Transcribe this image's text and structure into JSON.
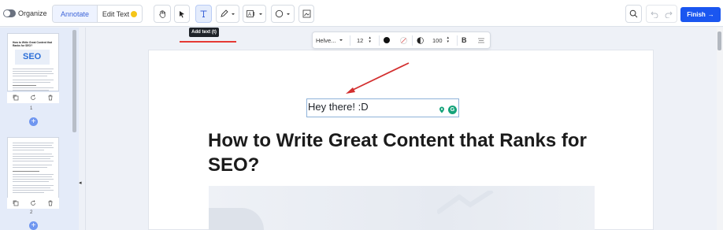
{
  "toolbar": {
    "organize_label": "Organize",
    "annotate_label": "Annotate",
    "edit_text_label": "Edit Text",
    "finish_label": "Finish"
  },
  "tooltip": {
    "text": "Add text (t)"
  },
  "text_format": {
    "font": "Helve...",
    "size": "12",
    "opacity": "100",
    "bold": "B"
  },
  "document": {
    "textbox_value": "Hey there! :D",
    "heading": "How to Write Great Content that Ranks for SEO?"
  },
  "sidebar": {
    "pages": [
      {
        "number": "1",
        "thumb_title": "How to Write Great Content that Ranks for SEO?",
        "thumb_logo": "SEO"
      },
      {
        "number": "2"
      }
    ]
  },
  "colors": {
    "accent": "#1a56f0",
    "annotation_red": "#e53935",
    "sidebar_bg": "#e4ebf9"
  },
  "icons": [
    "hand-icon",
    "pointer-icon",
    "text-tool-icon",
    "pen-icon",
    "text-style-icon",
    "shape-circle-icon",
    "image-icon",
    "search-icon",
    "undo-icon",
    "redo-icon",
    "copy-icon",
    "rotate-icon",
    "trash-icon",
    "plus-icon"
  ]
}
